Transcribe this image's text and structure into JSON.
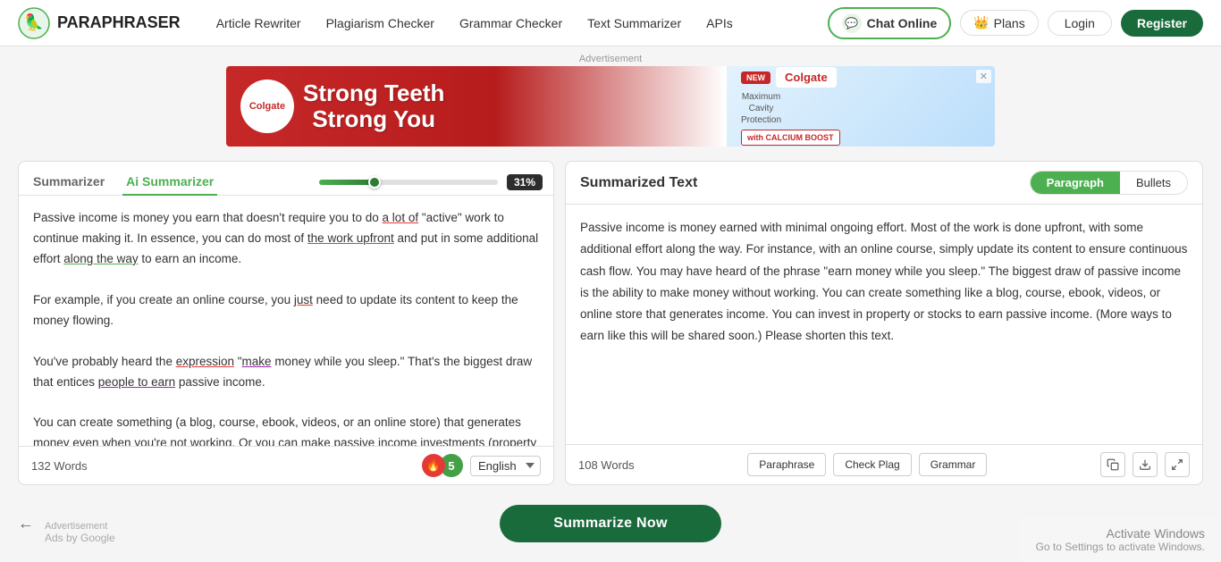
{
  "brand": {
    "name": "PARAPHRASER"
  },
  "navbar": {
    "links": [
      {
        "label": "Article Rewriter",
        "id": "article-rewriter"
      },
      {
        "label": "Plagiarism Checker",
        "id": "plagiarism-checker"
      },
      {
        "label": "Grammar Checker",
        "id": "grammar-checker"
      },
      {
        "label": "Text Summarizer",
        "id": "text-summarizer"
      },
      {
        "label": "APIs",
        "id": "apis"
      }
    ],
    "chat_label": "Chat Online",
    "plans_label": "Plans",
    "login_label": "Login",
    "register_label": "Register"
  },
  "ad": {
    "label": "Advertisement",
    "headline_line1": "Strong Teeth",
    "headline_line2": "Strong You",
    "brand": "Colgate",
    "new_label": "NEW",
    "description": "Maximum\nCavity\nProtection",
    "calcium": "with CALCIUM BOOST"
  },
  "left_panel": {
    "tab_summarizer": "Summarizer",
    "tab_ai": "Ai Summarizer",
    "slider_percent": "31%",
    "input_text": "Passive income is money you earn that doesn't require you to do a lot of \"active\" work to continue making it. In essence, you can do most of the work upfront and put in some additional effort along the way to earn an income.\n\nFor example, if you create an online course, you just need to update its content to keep the money flowing.\n\nYou've probably heard the expression \"make money while you sleep.\" That's the biggest draw that entices people to earn passive income.\n\nYou can create something (a blog, course, ebook, videos, or an online store) that generates money even when you're not working. Or you can make passive income investments (property or stocks) that allow you to earn passively. (We'll tell you more ways to earn like this shortly.)",
    "word_count": "132 Words",
    "language": "English",
    "badge_count": "5"
  },
  "right_panel": {
    "title": "Summarized Text",
    "toggle_paragraph": "Paragraph",
    "toggle_bullets": "Bullets",
    "output_text": "Passive income is money earned with minimal ongoing effort. Most of the work is done upfront, with some additional effort along the way. For instance, with an online course, simply update its content to ensure continuous cash flow. You may have heard of the phrase \"earn money while you sleep.\" The biggest draw of passive income is the ability to make money without working. You can create something like a blog, course, ebook, videos, or online store that generates income. You can invest in property or stocks to earn passive income. (More ways to earn like this will be shared soon.) Please shorten this text.",
    "word_count": "108 Words",
    "btn_paraphrase": "Paraphrase",
    "btn_check_plag": "Check Plag",
    "btn_grammar": "Grammar"
  },
  "bottom": {
    "summarize_btn": "Summarize Now",
    "ad_label": "Advertisement",
    "ads_by": "Ads by Google"
  },
  "windows": {
    "title": "Activate Windows",
    "subtitle": "Go to Settings to activate Windows."
  }
}
